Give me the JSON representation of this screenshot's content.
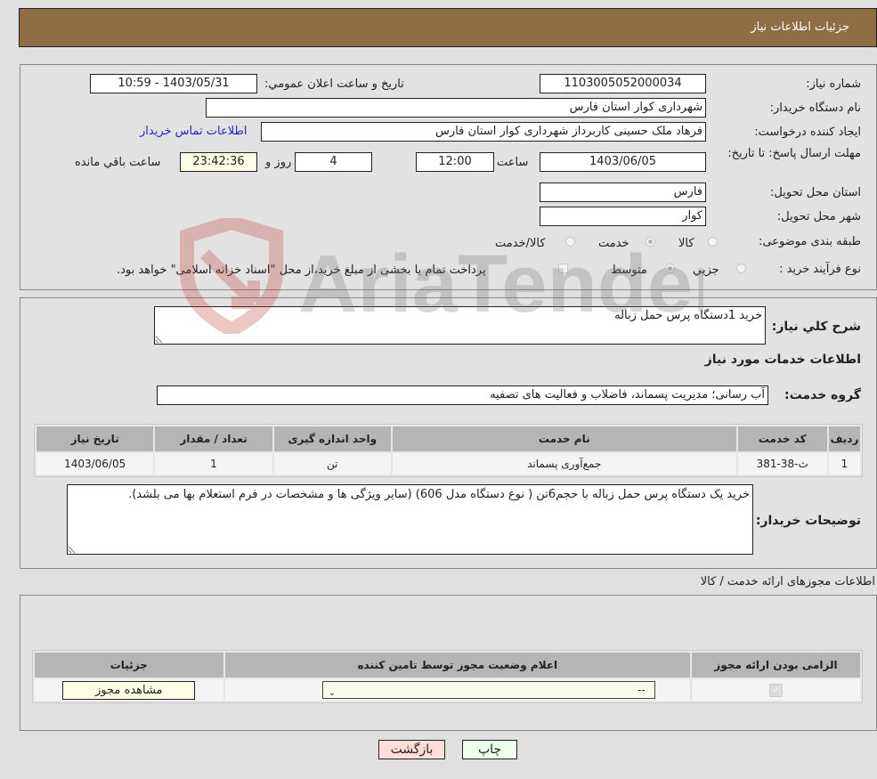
{
  "header": {
    "title": "جزئيات اطلاعات نياز"
  },
  "details": {
    "need_number_label": "شماره نياز:",
    "need_number": "1103005052000034",
    "announce_label": "تاريخ و ساعت اعلان عمومي:",
    "announce_value": "1403/05/31 - 10:59",
    "buyer_org_label": "نام دستگاه خريدار:",
    "buyer_org": "شهرداری کوار استان فارس",
    "requester_label": "ايجاد کننده درخواست:",
    "requester": "فرهاد ملک حسینی کاربرداز شهرداری کوار استان فارس",
    "buyer_contact_link": "اطلاعات تماس خريدار",
    "deadline_label": "مهلت ارسال پاسخ: تا تاريخ:",
    "deadline_date": "1403/06/05",
    "time_label": "ساعت",
    "deadline_time": "12:00",
    "days_value": "4",
    "days_label": "روز و",
    "remaining_time": "23:42:36",
    "remaining_label": "ساعت باقي مانده",
    "province_label": "استان محل تحويل:",
    "province": "فارس",
    "city_label": "شهر محل تحويل:",
    "city": "کوار",
    "category_label": "طبقه بندی موضوعی:",
    "category_options": [
      "کالا",
      "خدمت",
      "کالا/خدمت"
    ],
    "category_selected": "خدمت",
    "process_label": "نوع فرآيند خريد :",
    "process_options": [
      "جزيي",
      "متوسط"
    ],
    "process_selected": "متوسط",
    "treasury_note": "پرداخت تمام يا بخشی از مبلغ خريد،از محل \"اسناد خزانه اسلامی\" خواهد بود."
  },
  "summary": {
    "general_desc_label": "شرح کلي نياز:",
    "general_desc": "خريد 1دستگاه پرس حمل زباله",
    "services_heading": "اطلاعات خدمات مورد نياز",
    "service_group_label": "گروه خدمت:",
    "service_group": "آب رسانی؛ مديريت پسماند، فاضلاب و فعاليت های تصفيه",
    "table": {
      "headers": [
        "رديف",
        "کد خدمت",
        "نام خدمت",
        "واحد اندازه گيری",
        "تعداد / مقدار",
        "تاريخ نياز"
      ],
      "rows": [
        [
          "1",
          "ث-38-381",
          "جمع‌آوری پسماند",
          "تن",
          "1",
          "1403/06/05"
        ]
      ]
    },
    "buyer_notes_label": "توضيحات خريدار:",
    "buyer_notes": "خريد يک دستگاه پرس حمل زباله با حجم6تن ( نوع دستگاه مدل 606) (ساير ويژگی ها و مشخصات در فرم استعلام بها می بلشد)."
  },
  "permits": {
    "section_title": "اطلاعات مجوزهای ارائه خدمت / کالا",
    "headers": [
      "الزامی بودن ارائه مجوز",
      "اعلام وضعيت مجوز توسط تامين کننده",
      "جزئيات"
    ],
    "row": {
      "required_checked": true,
      "status_value": "--",
      "details_button": "مشاهده مجوز"
    }
  },
  "footer": {
    "print_button": "چاپ",
    "back_button": "بازگشت",
    "print_color": "#eeffee",
    "back_color": "#ffdddd"
  },
  "watermark": {
    "text": "AriaTender.neT"
  }
}
